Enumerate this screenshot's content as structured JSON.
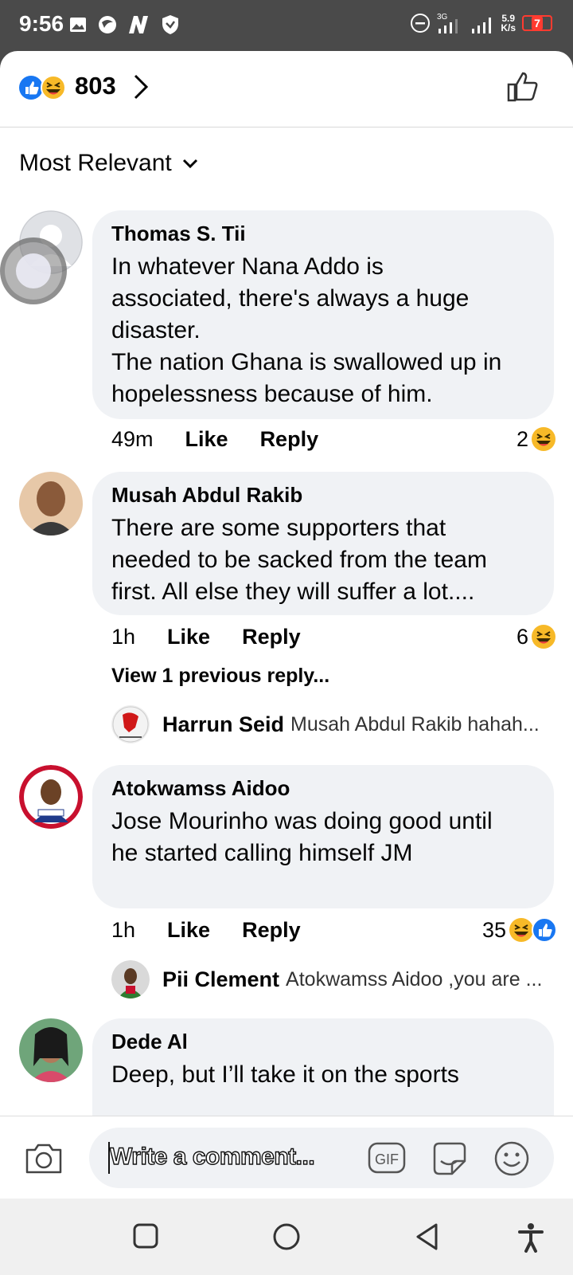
{
  "status": {
    "time": "9:56",
    "net_speed_top": "5.9",
    "net_speed_bottom": "K/s",
    "battery": "7"
  },
  "header": {
    "reaction_count": "803",
    "reactions": [
      "like",
      "haha"
    ]
  },
  "sort": {
    "label": "Most Relevant"
  },
  "comments": [
    {
      "author": "Thomas S. Tii",
      "text_lines": [
        "In whatever Nana Addo is",
        "associated, there's always a huge",
        "disaster.",
        "The nation Ghana is swallowed up in",
        "hopelessness because of him."
      ],
      "time": "49m",
      "like": "Like",
      "reply": "Reply",
      "reaction_count": "2"
    },
    {
      "author": "Musah Abdul Rakib",
      "text_lines": [
        "There are some supporters that",
        "needed to be sacked from the team",
        "first. All else they will suffer a lot...."
      ],
      "time": "1h",
      "like": "Like",
      "reply": "Reply",
      "reaction_count": "6",
      "view_previous": "View 1 previous reply...",
      "reply_preview": {
        "author": "Harrun Seid",
        "text": "Musah Abdul Rakib hahah..."
      }
    },
    {
      "author": "Atokwamss Aidoo",
      "text_lines": [
        "Jose Mourinho was doing good until",
        "he started calling himself JM"
      ],
      "time": "1h",
      "like": "Like",
      "reply": "Reply",
      "reaction_count": "35",
      "reply_preview": {
        "author": "Pii Clement",
        "text": "Atokwamss Aidoo ,you are ..."
      }
    },
    {
      "author": "Dede Al",
      "text_lines": [
        "Deep, but I’ll take it on the sports"
      ]
    }
  ],
  "composer": {
    "placeholder": "Write a comment..."
  },
  "colors": {
    "like_blue": "#1877f2",
    "haha_yellow": "#f7b928",
    "bubble": "#f0f2f5"
  }
}
